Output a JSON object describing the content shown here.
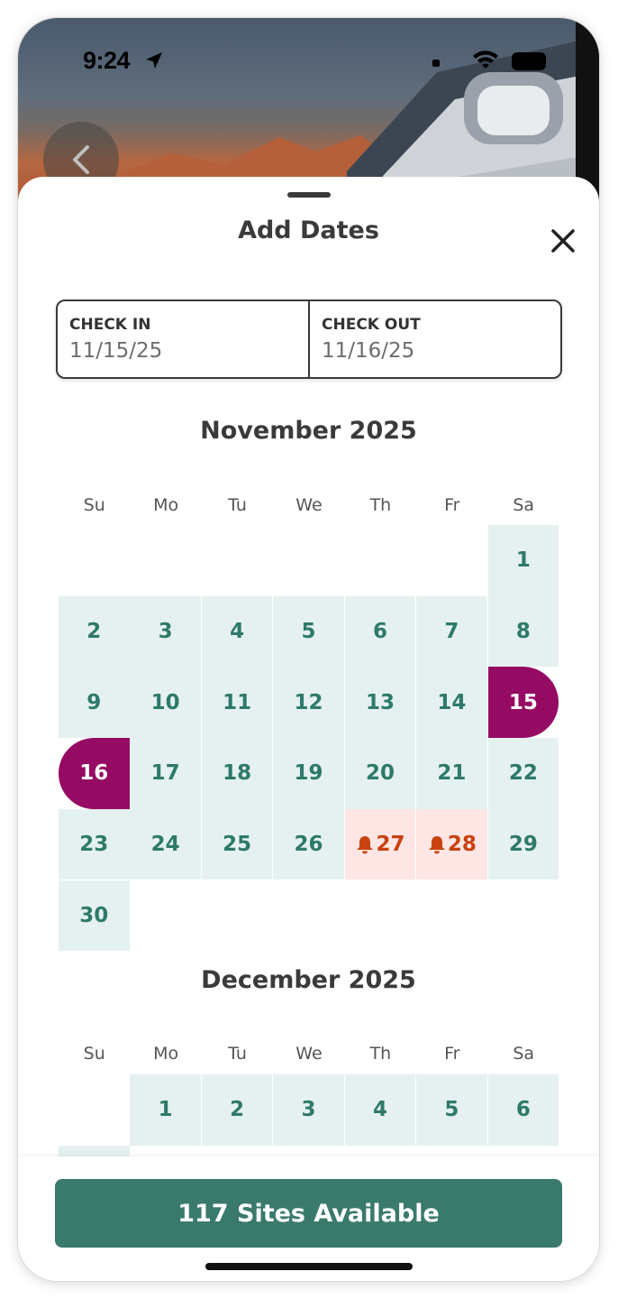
{
  "status_bar": {
    "time": "9:24"
  },
  "sheet": {
    "title": "Add Dates",
    "check_in": {
      "label": "CHECK IN",
      "value": "11/15/25"
    },
    "check_out": {
      "label": "CHECK OUT",
      "value": "11/16/25"
    }
  },
  "weekdays": [
    "Su",
    "Mo",
    "Tu",
    "We",
    "Th",
    "Fr",
    "Sa"
  ],
  "months": [
    {
      "title": "November 2025",
      "first_weekday": 6,
      "days": [
        "1",
        "2",
        "3",
        "4",
        "5",
        "6",
        "7",
        "8",
        "9",
        "10",
        "11",
        "12",
        "13",
        "14",
        "15",
        "16",
        "17",
        "18",
        "19",
        "20",
        "21",
        "22",
        "23",
        "24",
        "25",
        "26",
        "27",
        "28",
        "29",
        "30"
      ],
      "selected_start": "15",
      "selected_end": "16",
      "alert_days": [
        "27",
        "28"
      ]
    },
    {
      "title": "December 2025",
      "first_weekday": 1,
      "days": [
        "1",
        "2",
        "3",
        "4",
        "5",
        "6"
      ],
      "selected_start": "",
      "selected_end": "",
      "alert_days": []
    }
  ],
  "cta": {
    "label": "117 Sites Available"
  },
  "colors": {
    "selected": "#950b63",
    "available_bg": "#e5f1f0",
    "available_text": "#2e7a6a",
    "alert_bg": "#fde6e3",
    "alert_text": "#c9420f",
    "cta_bg": "#3a7a6c"
  },
  "icons": {
    "back": "chevron-left-icon",
    "close": "close-icon",
    "alert": "bell-icon"
  }
}
